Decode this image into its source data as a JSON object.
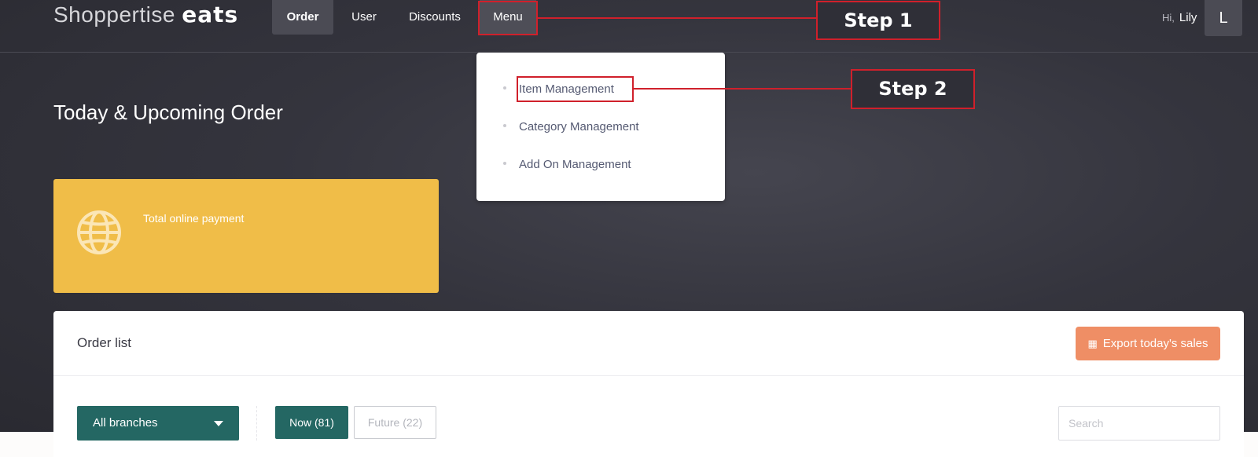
{
  "brand": {
    "name_thin": "Shoppertise",
    "name_bold": "eats"
  },
  "nav": {
    "order": "Order",
    "user": "User",
    "discounts": "Discounts",
    "menu": "Menu"
  },
  "user": {
    "greeting": "Hi,",
    "name": "Lily",
    "avatar_initial": "L"
  },
  "annotations": {
    "step1": "Step 1",
    "step2": "Step 2",
    "color": "#d0202b"
  },
  "menu_dropdown": {
    "items": [
      {
        "label": "Item Management"
      },
      {
        "label": "Category Management"
      },
      {
        "label": "Add On Management"
      }
    ]
  },
  "page": {
    "title": "Today & Upcoming Order"
  },
  "payment_card": {
    "label": "Total online payment",
    "icon": "globe-icon",
    "color": "#f0bd48"
  },
  "order_list": {
    "title": "Order list",
    "export_label": "Export today's sales",
    "export_icon": "spreadsheet-icon",
    "branch_select": "All branches",
    "tabs": {
      "now": "Now (81)",
      "future": "Future (22)"
    },
    "search_placeholder": "Search"
  },
  "colors": {
    "accent_teal": "#246763",
    "export_orange": "#ef8e65"
  }
}
